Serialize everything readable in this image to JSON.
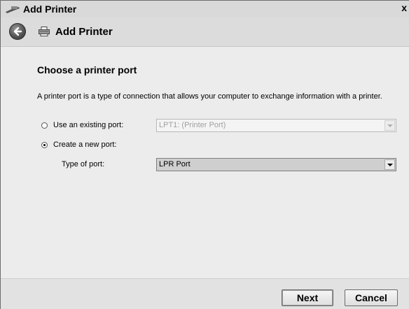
{
  "window": {
    "title": "Add Printer",
    "close_glyph": "x"
  },
  "header": {
    "back_icon": "back-arrow-icon",
    "printer_icon": "printer-icon",
    "title": "Add Printer"
  },
  "content": {
    "heading": "Choose a printer port",
    "description": "A printer port is a type of connection that allows your computer to exchange information with a printer.",
    "existing_port": {
      "label": "Use an existing port:",
      "selected": false,
      "value": "LPT1: (Printer Port)",
      "enabled": false
    },
    "new_port": {
      "label": "Create a new port:",
      "selected": true
    },
    "type_of_port": {
      "label": "Type of port:",
      "value": "LPR Port",
      "enabled": true
    }
  },
  "footer": {
    "next_label": "Next",
    "cancel_label": "Cancel"
  }
}
